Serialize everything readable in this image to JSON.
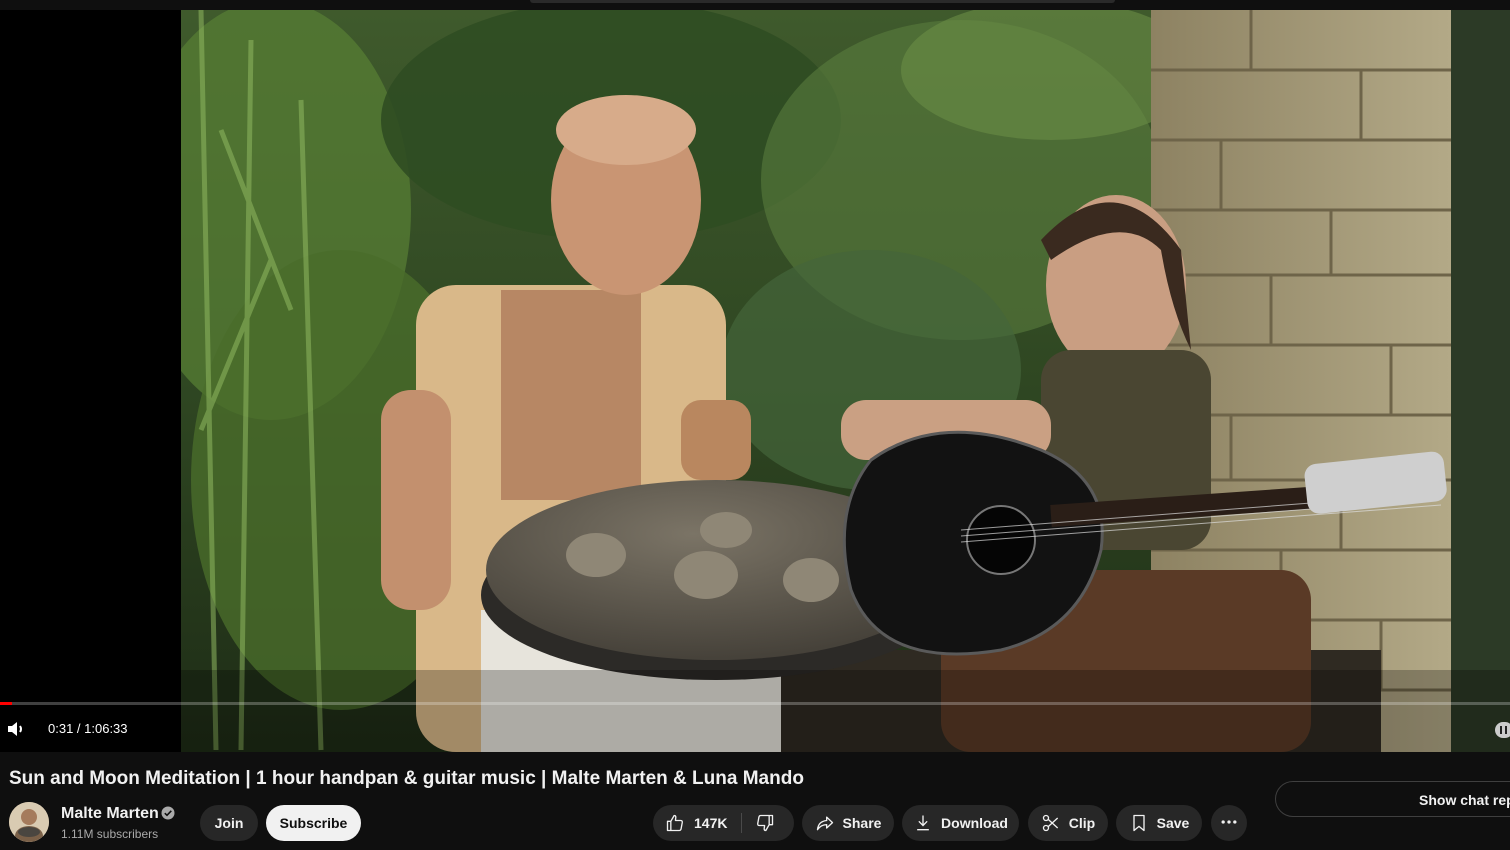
{
  "player": {
    "time_current": "0:31",
    "time_total": "1:06:33",
    "time_display": "0:31 / 1:06:33",
    "progress_fraction": 0.0078,
    "progress_color": "#ff0000"
  },
  "video": {
    "title": "Sun and Moon Meditation | 1 hour handpan & guitar music | Malte Marten & Luna Mando"
  },
  "channel": {
    "name": "Malte Marten",
    "subscribers": "1.11M subscribers",
    "verified_icon": "verified-check-icon"
  },
  "actions": {
    "join_label": "Join",
    "subscribe_label": "Subscribe",
    "like_count": "147K",
    "share_label": "Share",
    "download_label": "Download",
    "clip_label": "Clip",
    "save_label": "Save",
    "more_icon": "more-horizontal-icon"
  },
  "chat": {
    "show_replay_label": "Show chat replay"
  },
  "colors": {
    "background": "#0f0f0f",
    "button": "#272727",
    "subscribe_bg": "#f1f1f1",
    "text": "#f1f1f1",
    "muted": "#aaaaaa"
  }
}
